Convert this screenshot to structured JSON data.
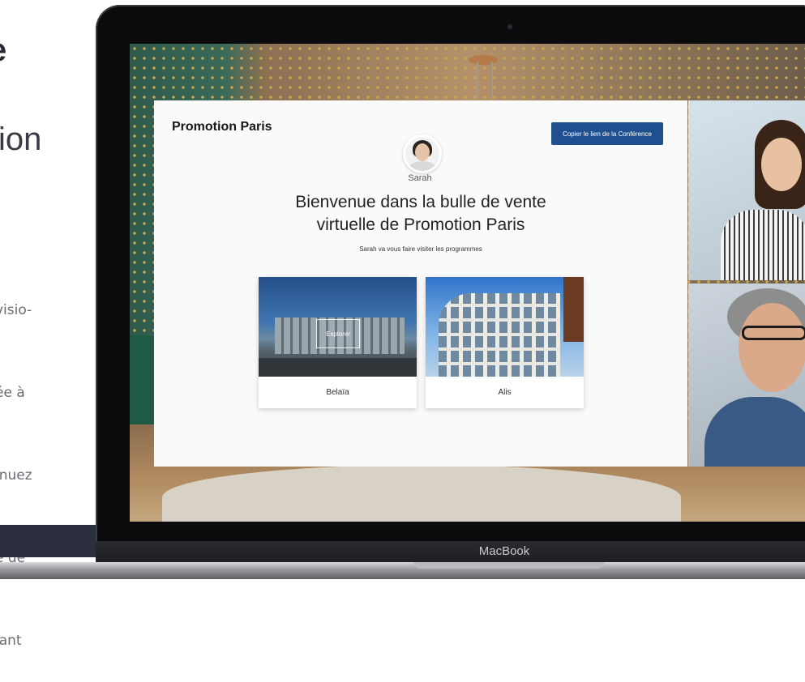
{
  "marketing": {
    "heading_fragment": "e",
    "subheading_fragment": "ion",
    "paragraph_lines": [
      "visio-",
      "ée à",
      "inuez",
      "e de",
      "lant"
    ]
  },
  "laptop": {
    "brand_label": "MacBook"
  },
  "app": {
    "brand": "Promotion Paris",
    "copy_link_button": "Copier le lien de la Conférence",
    "agent": {
      "name": "Sarah",
      "avatar_icon": "person-avatar-icon"
    },
    "headline_line1": "Bienvenue dans la bulle de vente",
    "headline_line2": "virtuelle de Promotion Paris",
    "subline": "Sarah va vous faire visiter les programmes",
    "programs": [
      {
        "name": "Belaïa",
        "hover_action": "Explorer"
      },
      {
        "name": "Alis"
      }
    ]
  },
  "colors": {
    "accent_button": "#1f4f8e",
    "card_background": "#fafafa"
  }
}
